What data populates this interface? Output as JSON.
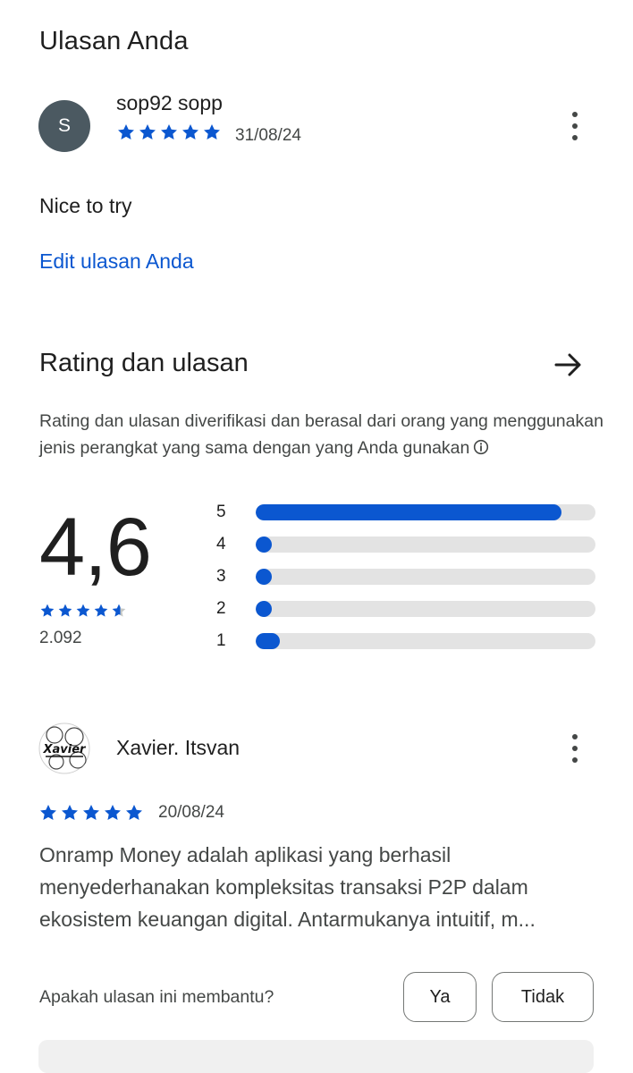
{
  "your_review": {
    "section_title": "Ulasan Anda",
    "avatar_letter": "S",
    "user_name": "sop92 sopp",
    "stars": 5,
    "date": "31/08/24",
    "text": "Nice to try",
    "edit_label": "Edit ulasan Anda"
  },
  "ratings": {
    "title": "Rating dan ulasan",
    "description": "Rating dan ulasan diverifikasi dan berasal dari orang yang menggunakan jenis perangkat yang sama dengan yang Anda gunakan",
    "average": "4,6",
    "average_stars": 4.6,
    "total_count": "2.092",
    "distribution": [
      {
        "label": "5",
        "fraction": 0.9
      },
      {
        "label": "4",
        "fraction": 0.02
      },
      {
        "label": "3",
        "fraction": 0.02
      },
      {
        "label": "2",
        "fraction": 0.02
      },
      {
        "label": "1",
        "fraction": 0.07
      }
    ]
  },
  "other_review": {
    "user_name": "Xavier. Itsvan",
    "avatar_text": "Xavier",
    "stars": 5,
    "date": "20/08/24",
    "text": "Onramp Money adalah aplikasi yang berhasil menyederhanakan kompleksitas transaksi P2P dalam ekosistem keuangan digital. Antarmukanya intuitif, m...",
    "helpful_question": "Apakah ulasan ini membantu?",
    "yes_label": "Ya",
    "no_label": "Tidak"
  },
  "colors": {
    "accent": "#0b57d0",
    "star": "#0b57d0",
    "track": "#e3e3e3",
    "avatar_bg": "#4b5961"
  },
  "icons": [
    "more-vert-icon",
    "arrow-right-icon",
    "info-icon",
    "star-icon"
  ]
}
